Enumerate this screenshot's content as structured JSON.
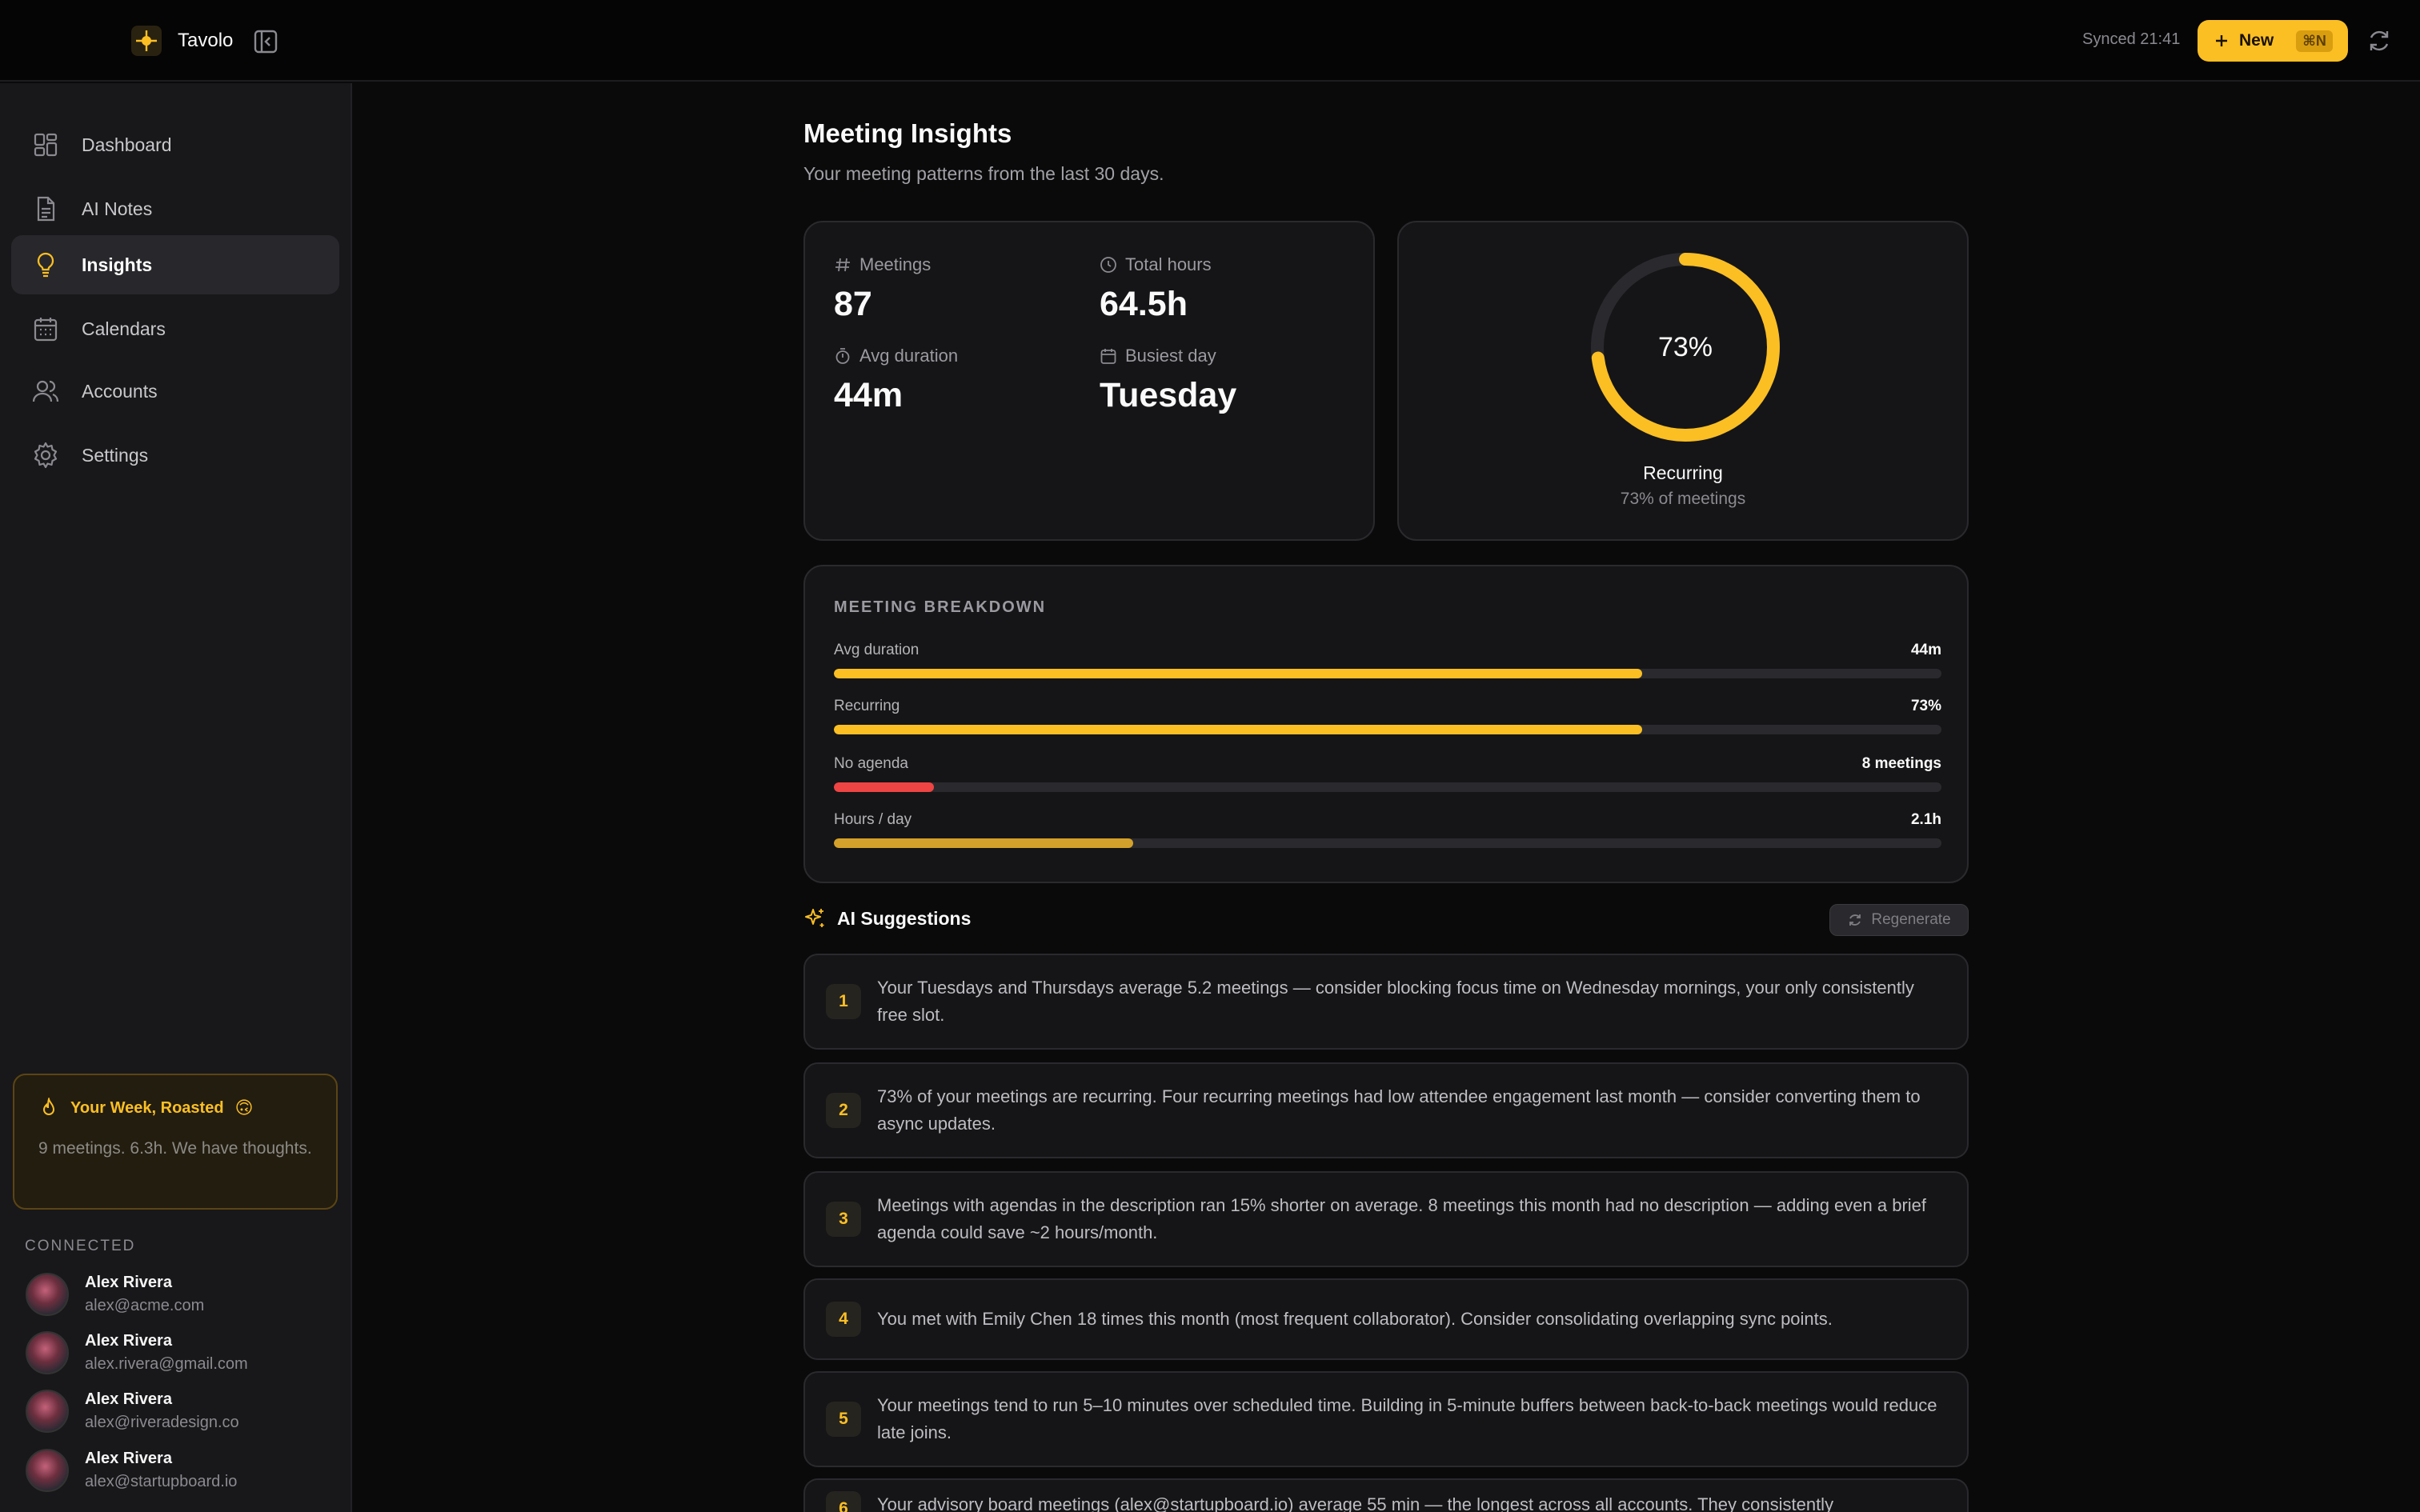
{
  "app": {
    "name": "Tavolo"
  },
  "topbar": {
    "synced": "Synced 21:41",
    "new_label": "New",
    "new_shortcut": "⌘N"
  },
  "sidebar": {
    "items": [
      {
        "label": "Dashboard",
        "icon": "dashboard-icon"
      },
      {
        "label": "AI Notes",
        "icon": "document-icon"
      },
      {
        "label": "Insights",
        "icon": "lightbulb-icon",
        "active": true
      },
      {
        "label": "Calendars",
        "icon": "calendar-icon"
      },
      {
        "label": "Accounts",
        "icon": "users-icon"
      },
      {
        "label": "Settings",
        "icon": "gear-icon"
      }
    ],
    "roast": {
      "title": "Your Week, Roasted",
      "emoji": "🙃",
      "text": "9 meetings. 6.3h. We have thoughts."
    },
    "connected_label": "CONNECTED",
    "accounts": [
      {
        "name": "Alex Rivera",
        "email": "alex@acme.com"
      },
      {
        "name": "Alex Rivera",
        "email": "alex.rivera@gmail.com"
      },
      {
        "name": "Alex Rivera",
        "email": "alex@riveradesign.co"
      },
      {
        "name": "Alex Rivera",
        "email": "alex@startupboard.io"
      }
    ]
  },
  "main": {
    "title": "Meeting Insights",
    "subtitle": "Your meeting patterns from the last 30 days.",
    "stats": [
      {
        "label": "Meetings",
        "value": "87",
        "icon": "hash-icon"
      },
      {
        "label": "Total hours",
        "value": "64.5h",
        "icon": "clock-icon"
      },
      {
        "label": "Avg duration",
        "value": "44m",
        "icon": "stopwatch-icon"
      },
      {
        "label": "Busiest day",
        "value": "Tuesday",
        "icon": "calendar-small-icon"
      }
    ],
    "recurring": {
      "percent": 73,
      "percent_label": "73%",
      "label": "Recurring",
      "sub": "73% of meetings"
    },
    "breakdown": {
      "title": "MEETING BREAKDOWN",
      "rows": [
        {
          "label": "Avg duration",
          "value": "44m",
          "fill": 0.73,
          "color": "#fbbf24"
        },
        {
          "label": "Recurring",
          "value": "73%",
          "fill": 0.73,
          "color": "#fbbf24"
        },
        {
          "label": "No agenda",
          "value": "8 meetings",
          "fill": 0.09,
          "color": "#ef4444"
        },
        {
          "label": "Hours / day",
          "value": "2.1h",
          "fill": 0.27,
          "color": "#d4a12a"
        }
      ]
    },
    "ai": {
      "title": "AI Suggestions",
      "regenerate_label": "Regenerate",
      "suggestions": [
        {
          "num": "1",
          "text": "Your Tuesdays and Thursdays average 5.2 meetings — consider blocking focus time on Wednesday mornings, your only consistently free slot."
        },
        {
          "num": "2",
          "text": "73% of your meetings are recurring. Four recurring meetings had low attendee engagement last month — consider converting them to async updates."
        },
        {
          "num": "3",
          "text": "Meetings with agendas in the description ran 15% shorter on average. 8 meetings this month had no description — adding even a brief agenda could save ~2 hours/month."
        },
        {
          "num": "4",
          "text": "You met with Emily Chen 18 times this month (most frequent collaborator). Consider consolidating overlapping sync points."
        },
        {
          "num": "5",
          "text": "Your meetings tend to run 5–10 minutes over scheduled time. Building in 5-minute buffers between back-to-back meetings would reduce late joins."
        },
        {
          "num": "6",
          "text": "Your advisory board meetings (alex@startupboard.io) average 55 min — the longest across all accounts. They consistently"
        }
      ]
    }
  },
  "colors": {
    "accent": "#fbbf24",
    "danger": "#ef4444",
    "background": "#0a0a0b",
    "sidebar": "#18181a"
  }
}
